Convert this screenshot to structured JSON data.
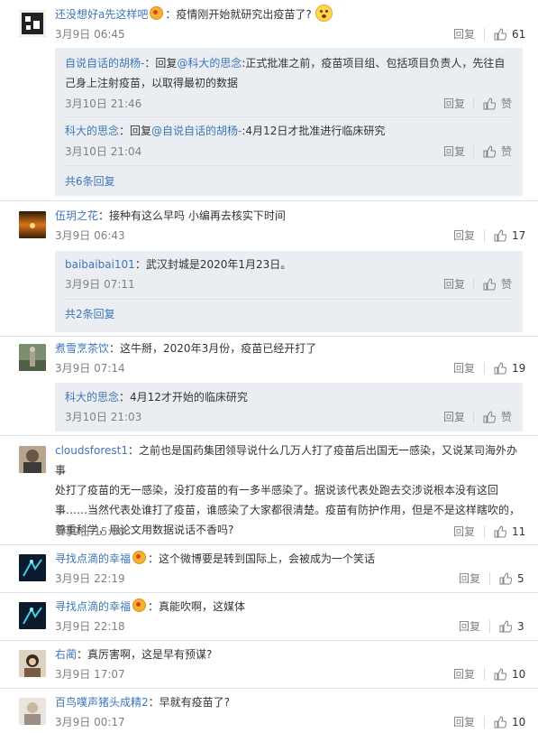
{
  "ui": {
    "reply_label": "回复",
    "like_label": "赞"
  },
  "comments": [
    {
      "user": "还没想好a先这样吧",
      "sep": "：",
      "text": "疫情刚开始就研究出疫苗了?",
      "date": "3月9日 06:45",
      "likes": "61",
      "replies": [
        {
          "user": "自说自话的胡杨-",
          "prefix": "：回复",
          "mention": "@科大的思念",
          "text": ":正式批准之前，疫苗项目组、包括项目负责人，先往自己身上注射疫苗，以取得最初的数据",
          "date": "3月10日 21:46"
        },
        {
          "user": "科大的思念",
          "prefix": "：回复",
          "mention": "@自说自话的胡杨-",
          "text": ":4月12日才批准进行临床研究",
          "date": "3月10日 21:04"
        }
      ],
      "more": "共6条回复"
    },
    {
      "user": "伍玥之花",
      "sep": "：",
      "text": "接种有这么早吗 小编再去核实下时间",
      "date": "3月9日 06:43",
      "likes": "17",
      "replies": [
        {
          "user": "baibaibai101",
          "prefix": "：",
          "text": "武汉封城是2020年1月23日。",
          "date": "3月9日 07:11"
        }
      ],
      "more": "共2条回复"
    },
    {
      "user": "煮雪烹茶饮",
      "sep": "：",
      "text": "这牛掰，2020年3月份，疫苗已经开打了",
      "date": "3月9日 07:14",
      "likes": "19",
      "replies": [
        {
          "user": "科大的思念",
          "prefix": "：",
          "text": "4月12才开始的临床研究",
          "date": "3月10日 21:03"
        }
      ]
    },
    {
      "user": "cloudsforest1",
      "sep": "：",
      "text_lines": [
        "之前也是国药集团领导说什么几万人打了疫苗后出国无一感染，又说某司海外办事",
        "处打了疫苗的无一感染，没打疫苗的有一多半感染了。据说该代表处跑去交涉说根本没有这回",
        "事……当然代表处谁打了疫苗，谁感染了大家都很清楚。疫苗有防护作用，但是不是这样瞎吹的，",
        "尊重科学，用论文用数据说话不香吗?"
      ],
      "date": "3月9日 15:08",
      "likes": "11"
    },
    {
      "user": "寻找点滴的幸福",
      "sep": "：",
      "text": "这个微博要是转到国际上，会被成为一个笑话",
      "date": "3月9日 22:19",
      "likes": "5"
    },
    {
      "user": "寻找点滴的幸福",
      "sep": "：",
      "text": "真能吹啊，这媒体",
      "date": "3月9日 22:18",
      "likes": "3"
    },
    {
      "user": "右蔺",
      "sep": "：",
      "text": "真厉害啊，这是早有预谋?",
      "date": "3月9日 17:07",
      "likes": "10"
    },
    {
      "user": "百鸟噗声猪头成精2",
      "sep": "：",
      "text": "早就有疫苗了?",
      "date": "3月9日 00:17",
      "likes": "10"
    }
  ]
}
